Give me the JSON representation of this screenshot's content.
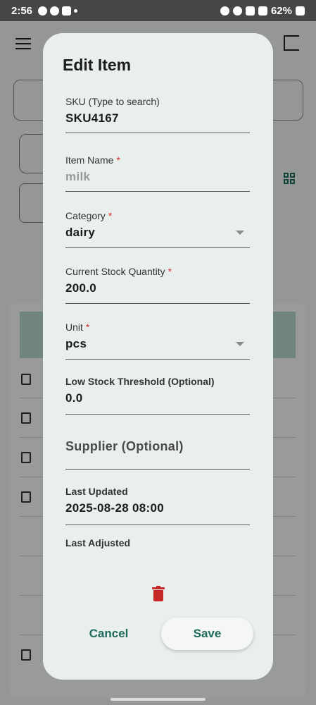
{
  "status_bar": {
    "time": "2:56",
    "battery": "62%"
  },
  "dialog": {
    "title": "Edit Item",
    "fields": {
      "sku": {
        "label": "SKU (Type to search)",
        "value": "SKU4167"
      },
      "item_name": {
        "label": "Item Name",
        "required": "*",
        "value": "milk"
      },
      "category": {
        "label": "Category",
        "required": "*",
        "value": "dairy"
      },
      "stock_quantity": {
        "label": "Current Stock Quantity",
        "required": "*",
        "value": "200.0"
      },
      "unit": {
        "label": "Unit",
        "required": "*",
        "value": "pcs"
      },
      "low_stock": {
        "label": "Low Stock Threshold (Optional)",
        "value": "0.0"
      },
      "supplier": {
        "placeholder": "Supplier (Optional)"
      },
      "last_updated": {
        "label": "Last Updated",
        "value": "2025-08-28 08:00"
      },
      "last_adjusted": {
        "label": "Last Adjusted"
      }
    },
    "actions": {
      "cancel_label": "Cancel",
      "save_label": "Save"
    }
  },
  "colors": {
    "accent": "#1e6b5d",
    "required": "#d32f2f",
    "delete": "#c62828",
    "dialog_bg": "#e9efec"
  }
}
